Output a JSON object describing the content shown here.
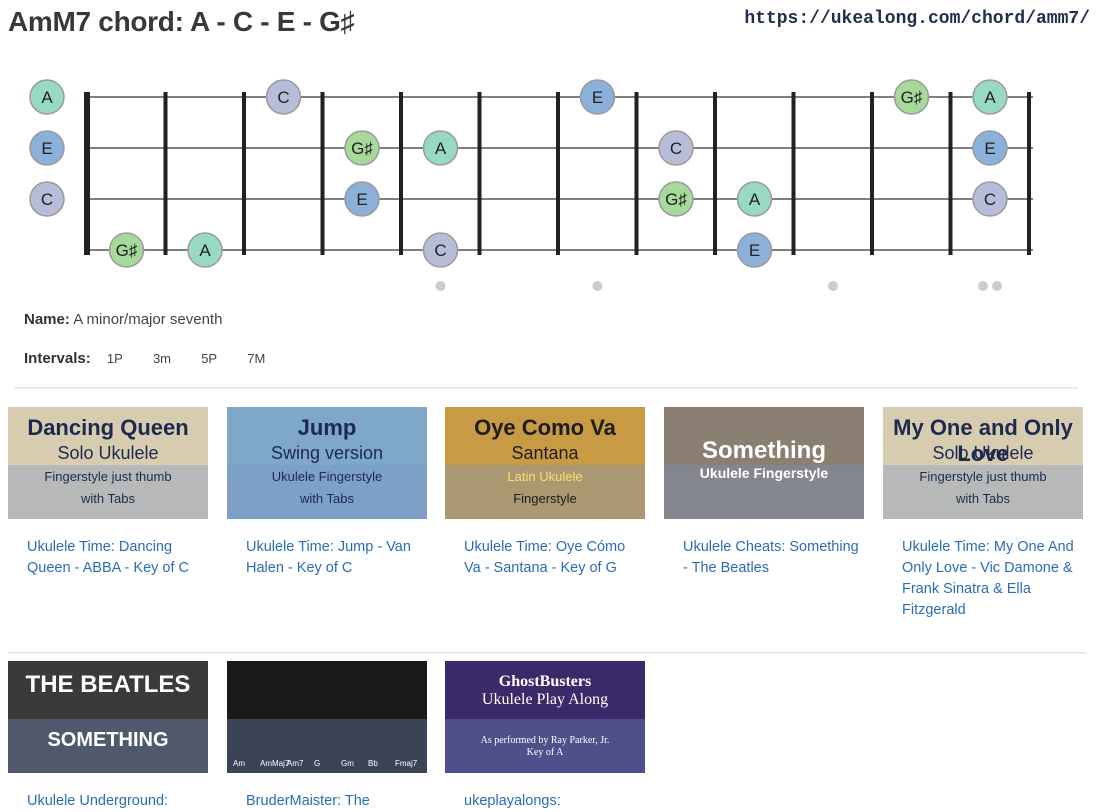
{
  "page": {
    "title": "AmM7 chord: A - C - E - G♯",
    "url": "https://ukealong.com/chord/amm7/"
  },
  "chord": {
    "name_label": "Name:",
    "name_value": "A minor/major seventh",
    "intervals_label": "Intervals:",
    "intervals": [
      "1P",
      "3m",
      "5P",
      "7M"
    ]
  },
  "fretboard": {
    "colors": {
      "A": "#98d9c4",
      "C": "#b7bdd9",
      "E": "#8bb0d9",
      "G♯": "#a6d99a"
    },
    "open_notes": [
      "A",
      "E",
      "C",
      ""
    ],
    "string_notes": [
      [
        {
          "fret": 0,
          "note": "A"
        },
        {
          "fret": 3,
          "note": "C"
        },
        {
          "fret": 7,
          "note": "E"
        },
        {
          "fret": 11,
          "note": "G♯"
        },
        {
          "fret": 12,
          "note": "A"
        }
      ],
      [
        {
          "fret": 0,
          "note": "E"
        },
        {
          "fret": 4,
          "note": "G♯"
        },
        {
          "fret": 5,
          "note": "A"
        },
        {
          "fret": 8,
          "note": "C"
        },
        {
          "fret": 12,
          "note": "E"
        }
      ],
      [
        {
          "fret": 0,
          "note": "C"
        },
        {
          "fret": 4,
          "note": "E"
        },
        {
          "fret": 8,
          "note": "G♯"
        },
        {
          "fret": 9,
          "note": "A"
        },
        {
          "fret": 12,
          "note": "C"
        }
      ],
      [
        {
          "fret": 1,
          "note": "G♯"
        },
        {
          "fret": 2,
          "note": "A"
        },
        {
          "fret": 5,
          "note": "C"
        },
        {
          "fret": 9,
          "note": "E"
        }
      ]
    ],
    "fret_markers": [
      5,
      7,
      10
    ],
    "double_marker_fret": 12,
    "fret_count": 12
  },
  "videos": [
    {
      "title": "Ukulele Time: Dancing Queen - ABBA - Key of C",
      "thumb_lines": [
        "Dancing Queen",
        "Solo Ukulele",
        "Fingerstyle just thumb",
        "with Tabs"
      ],
      "bg": "#d8ccb0"
    },
    {
      "title": "Ukulele Time: Jump - Van Halen - Key of C",
      "thumb_lines": [
        "Jump",
        "Swing version",
        "Ukulele Fingerstyle",
        "with Tabs"
      ],
      "bg": "#7fa7c8"
    },
    {
      "title": "Ukulele Time: Oye Cómo Va - Santana - Key of G",
      "thumb_lines": [
        "Oye Como Va",
        "Santana",
        "Latin Ukulele",
        "Fingerstyle"
      ],
      "bg": "#c89a44"
    },
    {
      "title": "Ukulele Cheats: Something - The Beatles",
      "thumb_lines": [
        "Something",
        "Ukulele Fingerstyle"
      ],
      "bg": "#8a7f70"
    },
    {
      "title": "Ukulele Time: My One And Only Love - Vic Damone & Frank Sinatra & Ella Fitzgerald",
      "thumb_lines": [
        "My One and Only Love",
        "Solo Ukulele",
        "Fingerstyle just thumb",
        "with Tabs"
      ],
      "bg": "#d8ccb0"
    },
    {
      "title": "Ukulele Underground:",
      "thumb_lines": [
        "THE BEATLES",
        "SOMETHING"
      ],
      "bg": "#3a3a3a"
    },
    {
      "title": "BruderMaister: The",
      "thumb_lines": [
        "Am",
        "AmMaj7",
        "Am7",
        "G",
        "Gm",
        "Bb",
        "Fmaj7"
      ],
      "bg": "#1a1a1a"
    },
    {
      "title": "ukeplayalongs:",
      "thumb_lines": [
        "GhostBusters",
        "Ukulele Play Along",
        "As performed by Ray Parker, Jr.",
        "Key of A"
      ],
      "bg": "#3a2a6a"
    }
  ]
}
